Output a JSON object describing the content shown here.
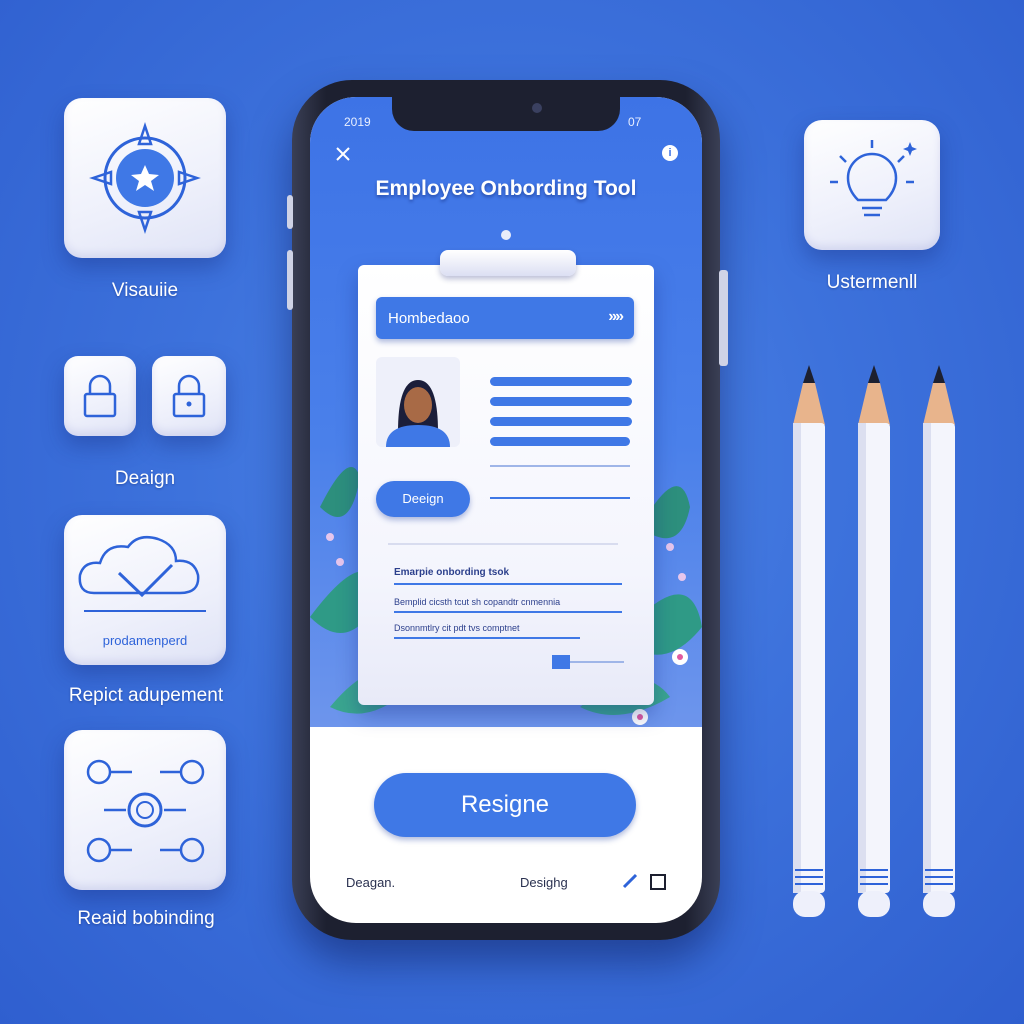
{
  "left_tiles": {
    "visual": {
      "label": "Visauiie",
      "icon": "compass-star-icon"
    },
    "locks": {
      "label": "Deaign",
      "icons": [
        "lock-icon",
        "lock-icon"
      ]
    },
    "product": {
      "label": "Repict adupement",
      "inner_text": "prodamenperd",
      "icon": "cloud-check-icon"
    },
    "onboarding": {
      "label": "Reaid bobinding",
      "icon": "flow-diagram-icon"
    }
  },
  "right_tile": {
    "label": "Ustermenll",
    "icon": "lightbulb-icon"
  },
  "phone": {
    "status_left": "2019",
    "status_right": "07",
    "app_title": "Employee Onbording Tool",
    "card": {
      "search_value": "Hombedaoo",
      "design_button": "Deeign",
      "checklist_heading": "Emarpie onbording tsok",
      "checklist_line_1": "Bemplid cicsth tcut sh copandtr cnmennia",
      "checklist_line_2": "Dsonnmtlry cit pdt tvs comptnet"
    },
    "primary_button": "Resigne",
    "bottom_left": "Deagan.",
    "bottom_right": "Desighg"
  },
  "colors": {
    "background": "#3d72dc",
    "accent": "#3f78e6",
    "tile": "#f3f4fc"
  }
}
